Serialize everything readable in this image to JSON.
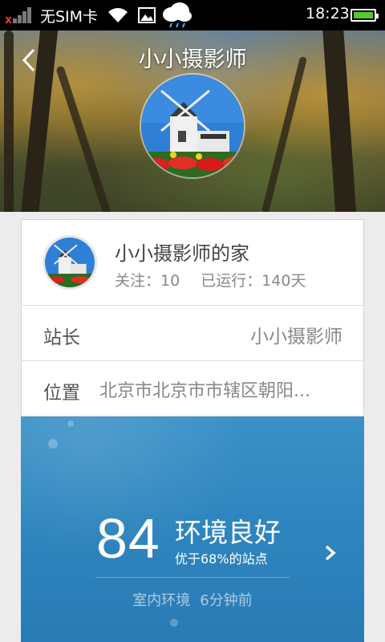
{
  "status_bar": {
    "carrier": "无SIM卡",
    "time": "18:23",
    "icons": [
      "no-signal-icon",
      "wifi-icon",
      "gallery-icon",
      "weather-rain-icon",
      "battery-icon"
    ]
  },
  "header": {
    "title": "小小摄影师",
    "back_icon": "chevron-left-icon"
  },
  "profile": {
    "name": "小小摄影师的家",
    "follow": "关注：10",
    "running": "已运行：140天"
  },
  "details": {
    "owner_label": "站长",
    "owner_value": "小小摄影师",
    "location_label": "位置",
    "location_value": "北京市北京市市辖区朝阳..."
  },
  "air_quality": {
    "score": "84",
    "status": "环境良好",
    "compare": "优于68%的站点",
    "env_type": "室内环境",
    "updated": "6分钟前",
    "arrow_icon": "chevron-right-icon"
  },
  "colors": {
    "status_bar_bg": "#000000",
    "battery_fill": "#56c82a",
    "panel_blue": "#2f86bf"
  }
}
